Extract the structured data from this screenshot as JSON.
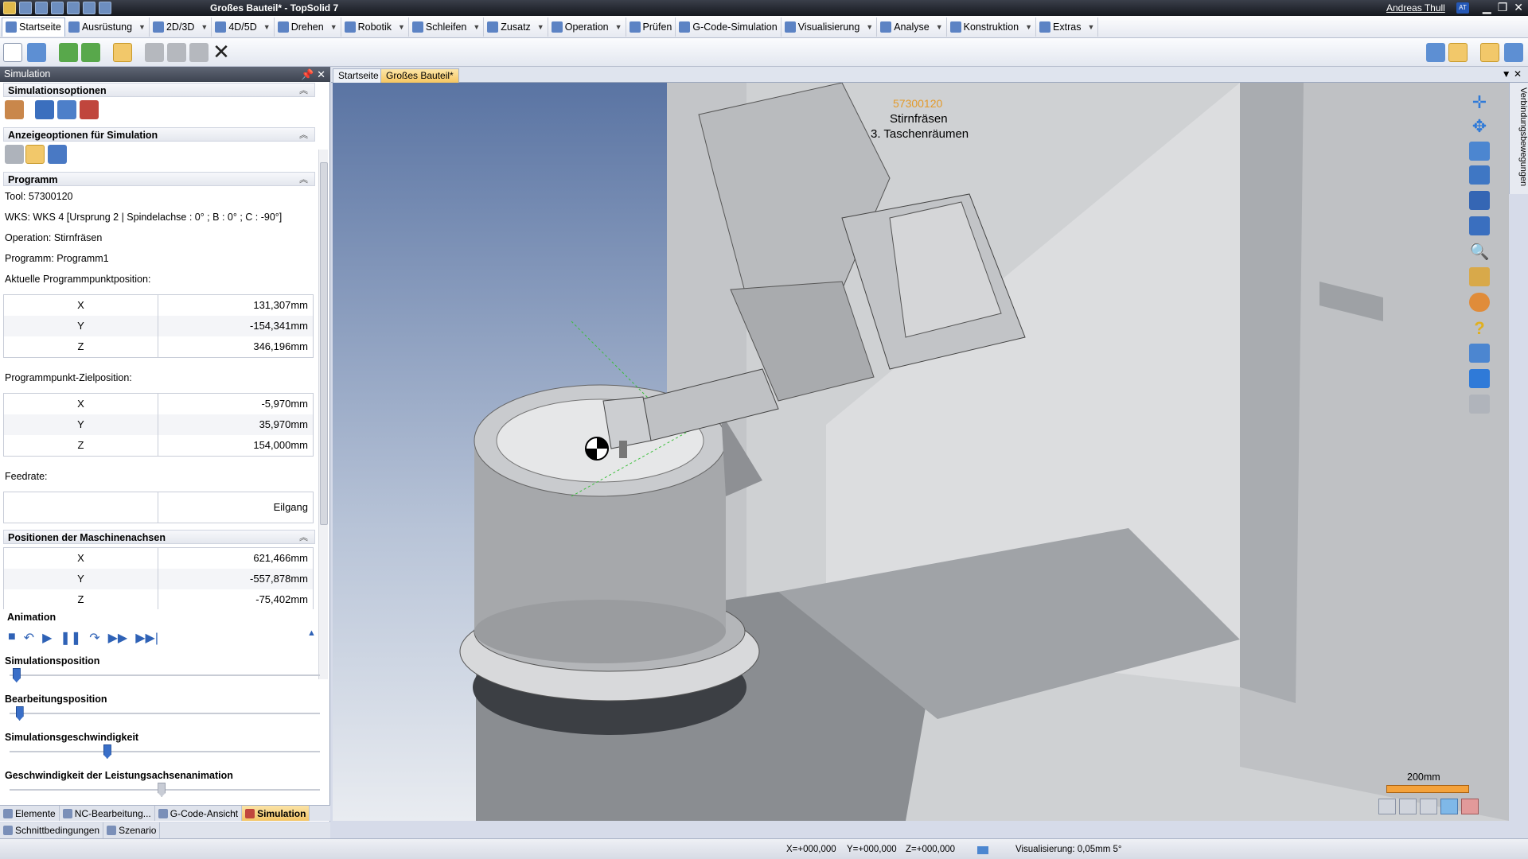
{
  "window": {
    "title": "Großes Bauteil* - TopSolid 7",
    "user": "Andreas Thull",
    "user_badge": "AT"
  },
  "menu": [
    {
      "label": "Startseite"
    },
    {
      "label": "Ausrüstung"
    },
    {
      "label": "2D/3D"
    },
    {
      "label": "4D/5D"
    },
    {
      "label": "Drehen"
    },
    {
      "label": "Robotik"
    },
    {
      "label": "Schleifen"
    },
    {
      "label": "Zusatz"
    },
    {
      "label": "Operation"
    },
    {
      "label": "Prüfen"
    },
    {
      "label": "G-Code-Simulation"
    },
    {
      "label": "Visualisierung"
    },
    {
      "label": "Analyse"
    },
    {
      "label": "Konstruktion"
    },
    {
      "label": "Extras"
    }
  ],
  "panel": {
    "title": "Simulation",
    "sections": {
      "sim_options": "Simulationsoptionen",
      "display_options": "Anzeigeoptionen für Simulation",
      "program": "Programm",
      "machine_axes": "Positionen der Maschinenachsen",
      "animation": "Animation"
    },
    "program": {
      "tool": "Tool: 57300120",
      "wks": "WKS: WKS 4 [Ursprung 2 | Spindelachse : 0° ; B : 0° ; C : -90°]",
      "operation": "Operation: Stirnfräsen",
      "program": "Programm: Programm1",
      "current_pos_label": "Aktuelle Programmpunktposition:",
      "current_pos": [
        {
          "axis": "X",
          "value": "131,307mm"
        },
        {
          "axis": "Y",
          "value": "-154,341mm"
        },
        {
          "axis": "Z",
          "value": "346,196mm"
        }
      ],
      "target_pos_label": "Programmpunkt-Zielposition:",
      "target_pos": [
        {
          "axis": "X",
          "value": "-5,970mm"
        },
        {
          "axis": "Y",
          "value": "35,970mm"
        },
        {
          "axis": "Z",
          "value": "154,000mm"
        }
      ],
      "feedrate_label": "Feedrate:",
      "feedrate_value": "Eilgang"
    },
    "machine_axes": [
      {
        "axis": "X",
        "value": "621,466mm"
      },
      {
        "axis": "Y",
        "value": "-557,878mm"
      },
      {
        "axis": "Z",
        "value": "-75,402mm"
      }
    ],
    "sliders": {
      "sim_position": {
        "label": "Simulationsposition",
        "level": 0.01
      },
      "machining_position": {
        "label": "Bearbeitungsposition",
        "level": 0.02
      },
      "sim_speed": {
        "label": "Simulationsgeschwindigkeit",
        "level": 0.31
      },
      "power_axis_speed": {
        "label": "Geschwindigkeit der Leistungsachsenanimation",
        "level": 0.49
      }
    }
  },
  "bottom_tabs": [
    {
      "label": "Elemente"
    },
    {
      "label": "NC-Bearbeitung..."
    },
    {
      "label": "G-Code-Ansicht"
    },
    {
      "label": "Simulation"
    }
  ],
  "bottom_tabs2": [
    {
      "label": "Schnittbedingungen"
    },
    {
      "label": "Szenario"
    }
  ],
  "doc_tabs": [
    {
      "label": "Startseite"
    },
    {
      "label": "Großes Bauteil*"
    }
  ],
  "viewport": {
    "tool_code": "57300120",
    "operation": "Stirnfräsen",
    "step": "3. Taschenräumen",
    "scale": "200mm"
  },
  "side_tab": "Verbindungsbewegungen",
  "status": {
    "x": "X=+000,000",
    "y": "Y=+000,000",
    "z": "Z=+000,000",
    "visualization": "Visualisierung: 0,05mm 5°"
  },
  "colors": {
    "accent": "#f2c567",
    "panel_head": "#3d4350",
    "scale_bar": "#f4a23b"
  }
}
